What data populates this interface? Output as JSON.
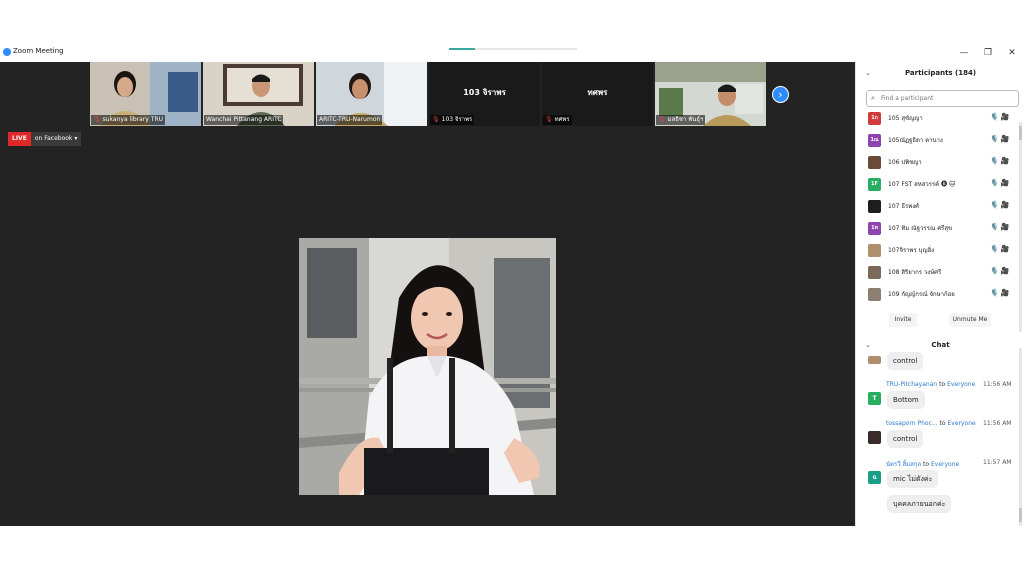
{
  "window": {
    "title": "Zoom Meeting",
    "progress_fraction": 0.2,
    "accent": "#2d8cff"
  },
  "gallery": {
    "tiles": [
      {
        "name": "sukanya library TRU",
        "muted": true,
        "video": true
      },
      {
        "name": "Wanchai Pittanang ARITC",
        "muted": false,
        "video": true
      },
      {
        "name": "ARITC-TRU-Narumon",
        "muted": false,
        "video": true
      },
      {
        "name": "103 จิราพร",
        "display_name": "103 จิราพร",
        "muted": true,
        "video": false
      },
      {
        "name": "ทศพร",
        "display_name": "ทศพร",
        "muted": true,
        "video": false
      },
      {
        "name": "มลธิชา พันธุ์ฯ",
        "muted": true,
        "video": true
      }
    ]
  },
  "live": {
    "badge": "LIVE",
    "platform": "on Facebook",
    "color": "#e02828"
  },
  "participants": {
    "title": "Participants (184)",
    "search_placeholder": "Find a participant",
    "items": [
      {
        "avatar": "1ก",
        "avatar_color": "#d03b3b",
        "name": "105 สุขัญญา"
      },
      {
        "avatar": "1ณ",
        "avatar_color": "#8e44ad",
        "name": "105ณัฏฐธิดา ตานาง"
      },
      {
        "avatar": "",
        "avatar_color": "#6b4a3a",
        "name": "106 ปพิชญา"
      },
      {
        "avatar": "1F",
        "avatar_color": "#27ae60",
        "name": "107 FST สหสวรรค์ 🅑 🐱"
      },
      {
        "avatar": "",
        "avatar_color": "#1e1e1e",
        "name": "107 ธีรพงศ์"
      },
      {
        "avatar": "1ท",
        "avatar_color": "#8e44ad",
        "name": "107 ทิม ณัฐวรรณ ศรีสุข"
      },
      {
        "avatar": "",
        "avatar_color": "#b08f6e",
        "name": "107จิราพร บุญอิ่ง"
      },
      {
        "avatar": "",
        "avatar_color": "#7a6a5a",
        "name": "108 สิริยากร วงษ์ศรี"
      },
      {
        "avatar": "",
        "avatar_color": "#8a7f70",
        "name": "109 กัญญ์กรณ์ จักษาก้อย"
      }
    ],
    "invite_label": "Invite",
    "unmute_label": "Unmute Me",
    "status_icons": "🎙️🎥"
  },
  "chat": {
    "title": "Chat",
    "messages": [
      {
        "sender": "",
        "recipient": "",
        "time": "",
        "text": "control",
        "avatar": "",
        "avatar_color": "#b08f6e"
      },
      {
        "sender": "TRU-Pitchayanan",
        "to": "to",
        "recipient": "Everyone",
        "time": "11:56 AM",
        "text": "Bottom",
        "avatar": "T",
        "avatar_color": "#27ae60"
      },
      {
        "sender": "tossaporn Phoc...",
        "to": "to",
        "recipient": "Everyone",
        "time": "11:56 AM",
        "text": "control",
        "avatar": "",
        "avatar_color": "#3a2a2a"
      },
      {
        "sender": "นัตรวี ลิ้มสกุล",
        "to": "to",
        "recipient": "Everyone",
        "time": "11:57 AM",
        "text": "mic ไม่ดังค่ะ",
        "text2": "บุคคลภายนอกค่ะ",
        "avatar": "ฉ",
        "avatar_color": "#16a085"
      }
    ]
  }
}
